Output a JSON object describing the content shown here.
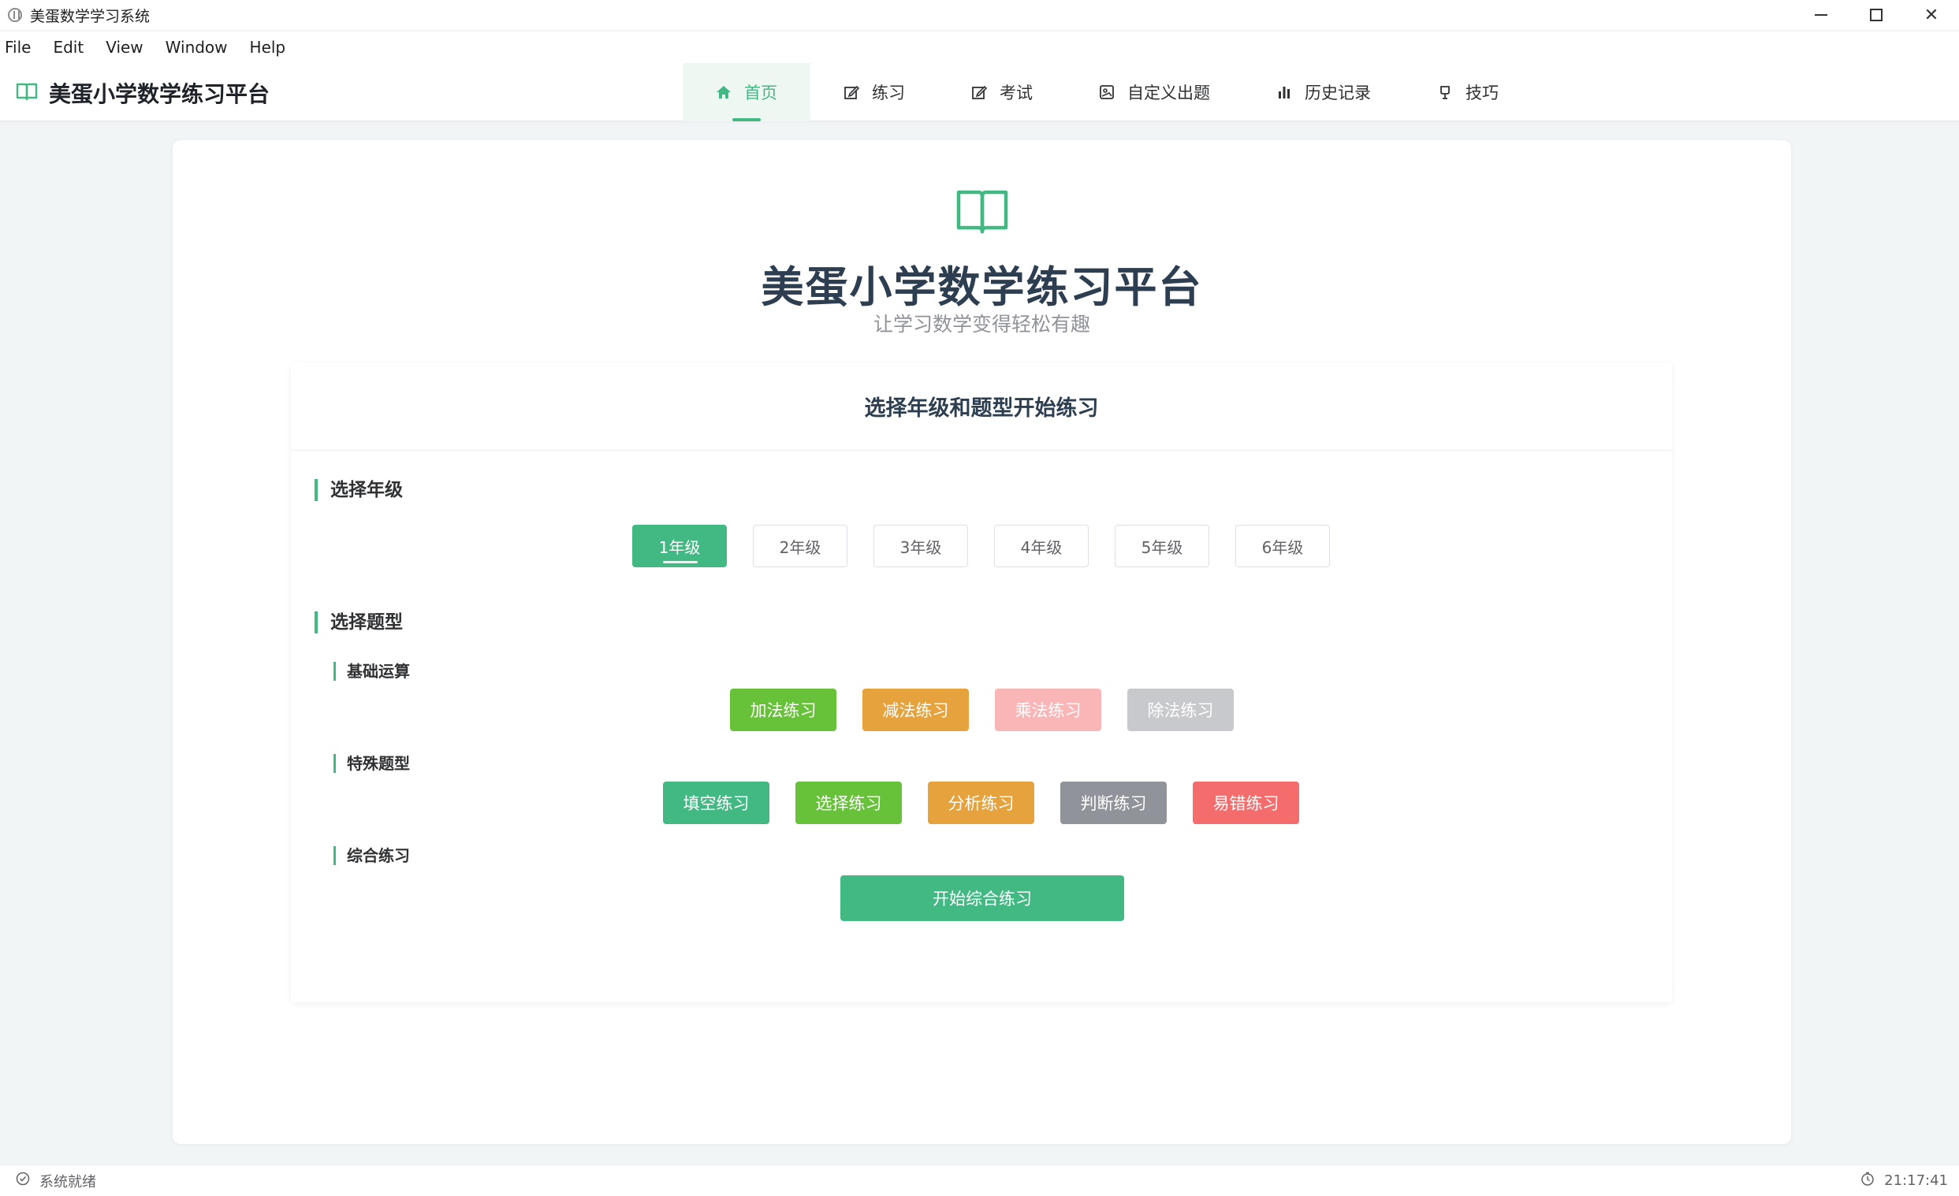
{
  "window": {
    "title": "美蛋数学学习系统",
    "minimize": "minimize",
    "maximize": "maximize",
    "close": "✕"
  },
  "menu": [
    "File",
    "Edit",
    "View",
    "Window",
    "Help"
  ],
  "header": {
    "brand": "美蛋小学数学练习平台",
    "tabs": [
      {
        "label": "首页",
        "icon": "home-icon",
        "active": true
      },
      {
        "label": "练习",
        "icon": "edit-icon"
      },
      {
        "label": "考试",
        "icon": "edit-icon"
      },
      {
        "label": "自定义出题",
        "icon": "picture-icon"
      },
      {
        "label": "历史记录",
        "icon": "bar-chart-icon"
      },
      {
        "label": "技巧",
        "icon": "lightbulb-icon"
      }
    ]
  },
  "hero": {
    "title": "美蛋小学数学练习平台",
    "subtitle": "让学习数学变得轻松有趣"
  },
  "panel": {
    "title": "选择年级和题型开始练习",
    "grade_section": "选择年级",
    "grades": [
      "1年级",
      "2年级",
      "3年级",
      "4年级",
      "5年级",
      "6年级"
    ],
    "selected_grade": "1年级",
    "type_section": "选择题型",
    "basic_label": "基础运算",
    "basic_types": [
      {
        "label": "加法练习",
        "color": "#67c23a"
      },
      {
        "label": "减法练习",
        "color": "#e6a23c"
      },
      {
        "label": "乘法练习",
        "color": "#fab6b6"
      },
      {
        "label": "除法练习",
        "color": "#c8c9cc"
      }
    ],
    "special_label": "特殊题型",
    "special_types": [
      {
        "label": "填空练习",
        "color": "#42b883"
      },
      {
        "label": "选择练习",
        "color": "#67c23a"
      },
      {
        "label": "分析练习",
        "color": "#e6a23c"
      },
      {
        "label": "判断练习",
        "color": "#909399"
      },
      {
        "label": "易错练习",
        "color": "#f56c6c"
      }
    ],
    "combo_label": "综合练习",
    "combo_button": "开始综合练习"
  },
  "status": {
    "left": "系统就绪",
    "time": "21:17:41"
  },
  "colors": {
    "accent": "#42b883"
  }
}
